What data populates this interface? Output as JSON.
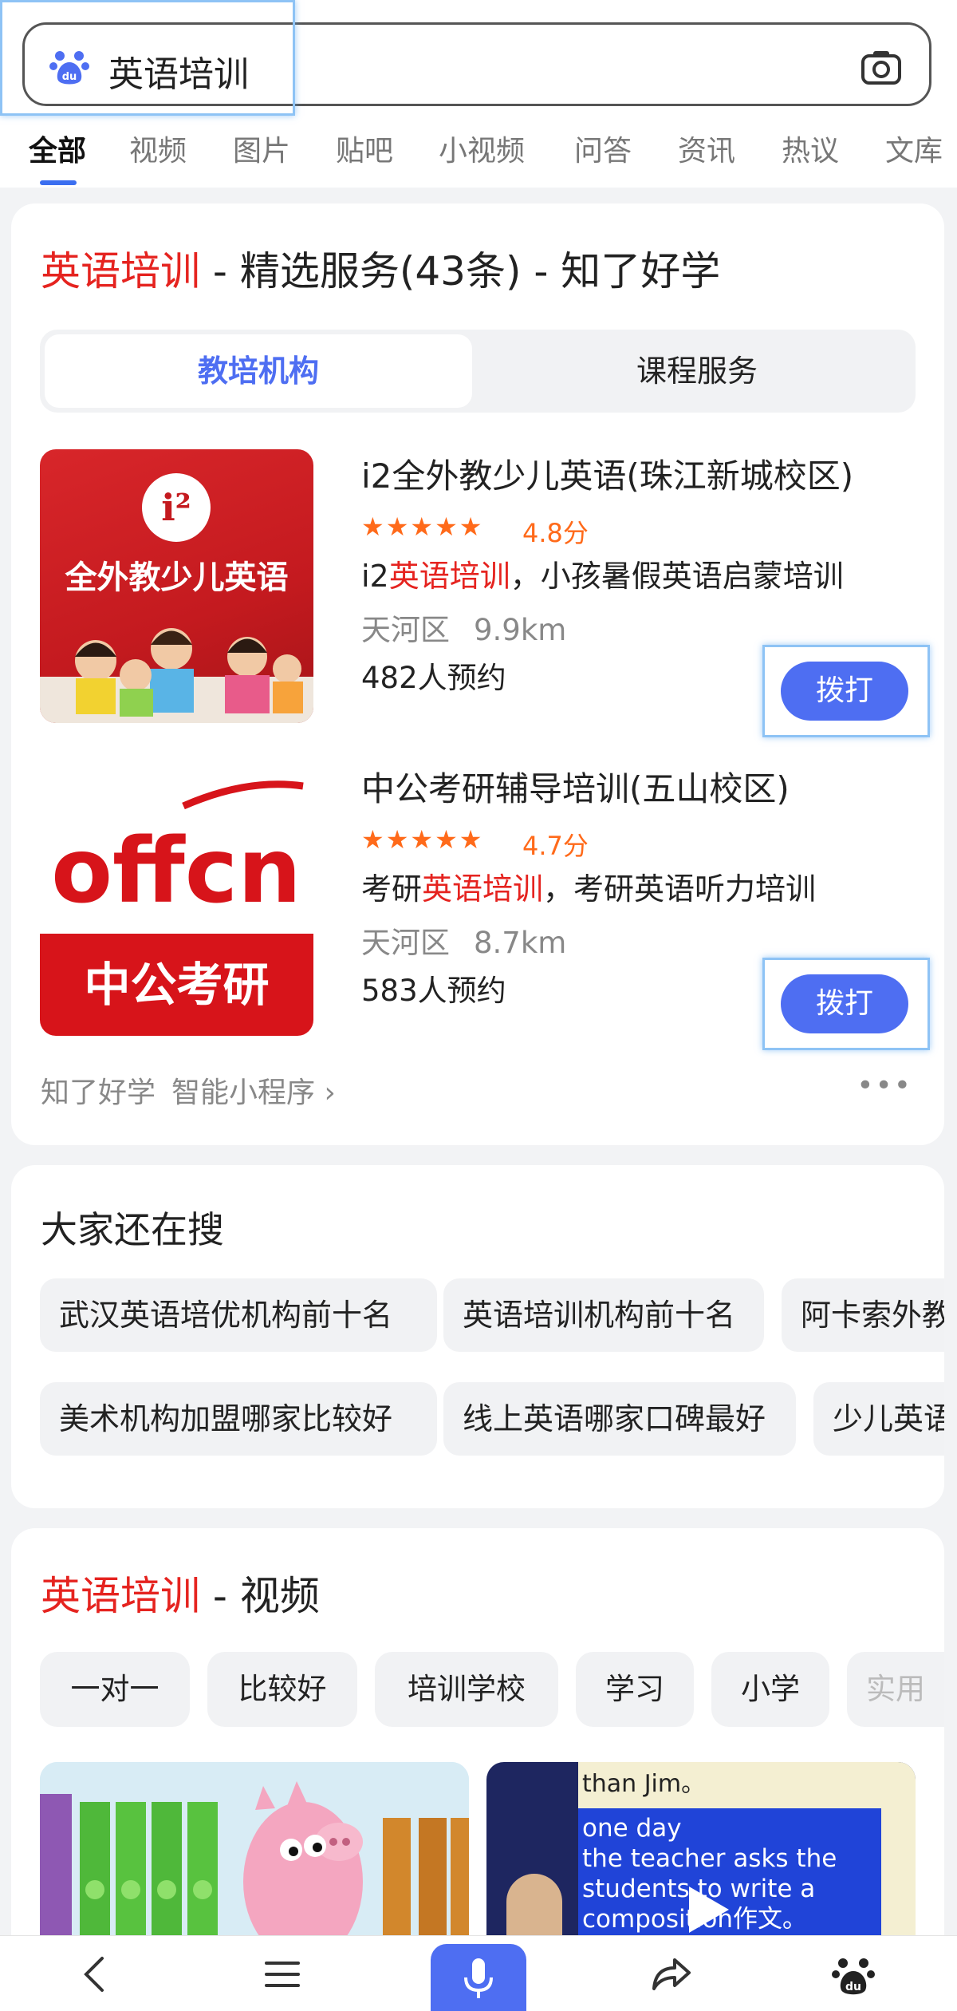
{
  "search": {
    "query": "英语培训",
    "camera_icon": "camera-icon",
    "logo_icon": "baidu-paw-icon"
  },
  "tabs": [
    "全部",
    "视频",
    "图片",
    "贴吧",
    "小视频",
    "问答",
    "资讯",
    "热议",
    "文库"
  ],
  "active_tab": "全部",
  "services_card": {
    "title_highlight": "英语培训",
    "title_rest": " - 精选服务(43条) - 知了好学",
    "segments": {
      "active": "教培机构",
      "inactive": "课程服务"
    },
    "institutions": [
      {
        "name": "i2全外教少儿英语(珠江新城校区)",
        "stars": "★★★★★",
        "rating": "4.8分",
        "desc_prefix": "i2",
        "desc_highlight": "英语培训",
        "desc_suffix": "，小孩暑假英语启蒙培训",
        "district": "天河区",
        "distance": "9.9km",
        "booked": "482人预约",
        "call_label": "拨打",
        "thumb_logo_text": "i²",
        "thumb_caption": "全外教少儿英语"
      },
      {
        "name": "中公考研辅导培训(五山校区)",
        "stars": "★★★★★",
        "rating": "4.7分",
        "desc_prefix": "考研",
        "desc_highlight": "英语培训",
        "desc_suffix": "，考研英语听力培训",
        "district": "天河区",
        "distance": "8.7km",
        "booked": "583人预约",
        "call_label": "拨打",
        "thumb_logo_text": "offcn",
        "thumb_caption": "中公考研"
      }
    ],
    "footer_source": "知了好学",
    "footer_link": "智能小程序 ›",
    "more_label": "•••"
  },
  "related": {
    "title": "大家还在搜",
    "row1": [
      "武汉英语培优机构前十名",
      "英语培训机构前十名",
      "阿卡索外教"
    ],
    "row2": [
      "美术机构加盟哪家比较好",
      "线上英语哪家口碑最好",
      "少儿英语"
    ]
  },
  "video_card": {
    "title_highlight": "英语培训",
    "title_rest": " - 视频",
    "chips": [
      "一对一",
      "比较好",
      "培训学校",
      "学习",
      "小学",
      "实用"
    ],
    "thumb2_lines": [
      "than Jim。",
      "one day",
      "the teacher asks the",
      "students to write a",
      "composition作文。"
    ]
  },
  "bottom_nav": [
    "back-icon",
    "menu-icon",
    "microphone-icon",
    "share-icon",
    "baidu-paw-icon"
  ],
  "colors": {
    "accent": "#4e6ef2",
    "highlight_red": "#e5231f",
    "star_orange": "#ff6a1a"
  }
}
